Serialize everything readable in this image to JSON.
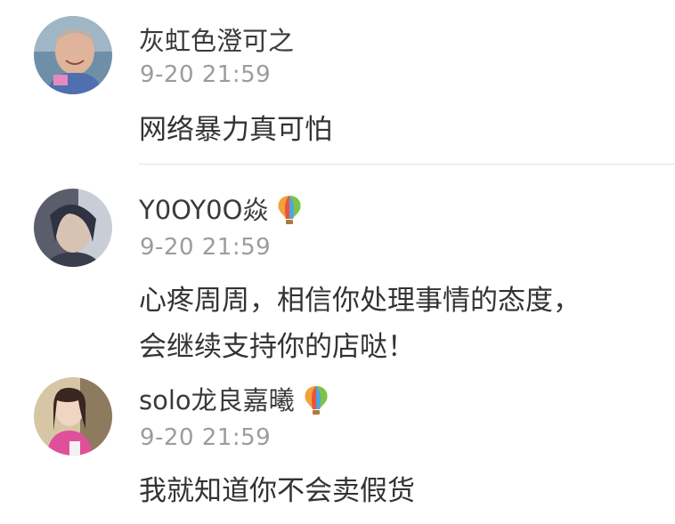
{
  "comments": [
    {
      "author": "灰虹色澄可之",
      "time": "9-20 21:59",
      "text": "网络暴力真可怕",
      "badge": ""
    },
    {
      "author": "Y0OY0O焱",
      "time": "9-20 21:59",
      "text": "心疼周周，相信你处理事情的态度，\n会继续支持你的店哒！",
      "badge": "hot-air-balloon-icon"
    },
    {
      "author": "solo龙良嘉曦",
      "time": "9-20 21:59",
      "text": "我就知道你不会卖假货",
      "badge": "hot-air-balloon-icon"
    }
  ],
  "colors": {
    "author": "#3a3a3a",
    "time": "#9c9c9c",
    "text": "#333333",
    "divider": "#e3e3e3"
  }
}
